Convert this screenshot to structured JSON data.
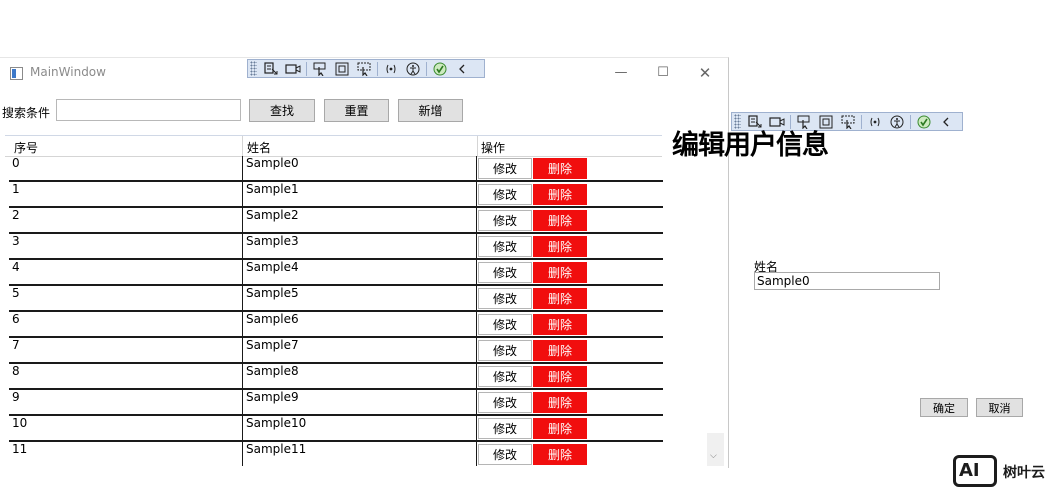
{
  "window": {
    "title": "MainWindow",
    "minimize_glyph": "—",
    "maximize_glyph": "☐",
    "close_glyph": "✕"
  },
  "search": {
    "label": "搜索条件",
    "value": "",
    "placeholder": ""
  },
  "toolbar": {
    "find_label": "查找",
    "reset_label": "重置",
    "add_label": "新增"
  },
  "grid": {
    "headers": [
      "序号",
      "姓名",
      "操作"
    ],
    "edit_label": "修改",
    "delete_label": "删除",
    "rows": [
      {
        "id": "0",
        "name": "Sample0"
      },
      {
        "id": "1",
        "name": "Sample1"
      },
      {
        "id": "2",
        "name": "Sample2"
      },
      {
        "id": "3",
        "name": "Sample3"
      },
      {
        "id": "4",
        "name": "Sample4"
      },
      {
        "id": "5",
        "name": "Sample5"
      },
      {
        "id": "6",
        "name": "Sample6"
      },
      {
        "id": "7",
        "name": "Sample7"
      },
      {
        "id": "8",
        "name": "Sample8"
      },
      {
        "id": "9",
        "name": "Sample9"
      },
      {
        "id": "10",
        "name": "Sample10"
      },
      {
        "id": "11",
        "name": "Sample11"
      }
    ]
  },
  "dialog": {
    "title": "编辑用户信息",
    "name_label": "姓名",
    "name_value": "Sample0",
    "ok_label": "确定",
    "cancel_label": "取消"
  },
  "debug_toolbar_icons": [
    "select-element-icon",
    "record-icon",
    "pointer-icon",
    "display-adorners-icon",
    "track-focus-icon",
    "binding-failures-icon",
    "accessibility-icon",
    "check-icon",
    "collapse-icon"
  ],
  "watermark": {
    "logo": "AI",
    "text": "树叶云"
  },
  "colors": {
    "delete_button": "#f10e0e",
    "debug_toolbar": "#dce6f4",
    "button_face": "#e1e1e1"
  }
}
